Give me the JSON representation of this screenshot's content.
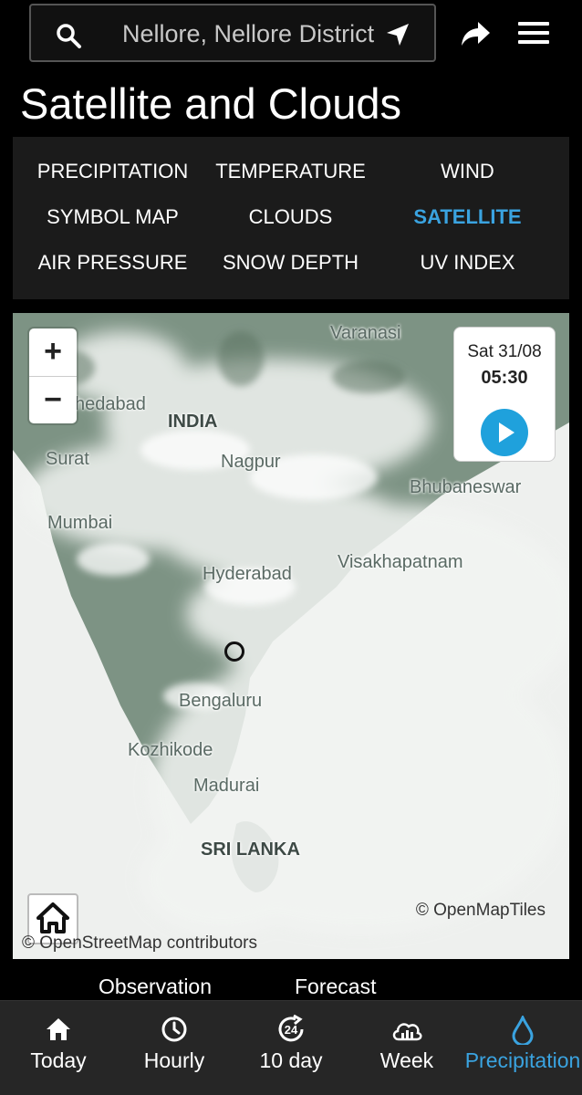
{
  "search": {
    "location_text": "Nellore, Nellore District"
  },
  "page": {
    "title": "Satellite and Clouds"
  },
  "map_types": [
    {
      "label": "PRECIPITATION",
      "active": false
    },
    {
      "label": "TEMPERATURE",
      "active": false
    },
    {
      "label": "WIND",
      "active": false
    },
    {
      "label": "SYMBOL MAP",
      "active": false
    },
    {
      "label": "CLOUDS",
      "active": false
    },
    {
      "label": "SATELLITE",
      "active": true
    },
    {
      "label": "AIR PRESSURE",
      "active": false
    },
    {
      "label": "SNOW DEPTH",
      "active": false
    },
    {
      "label": "UV INDEX",
      "active": false
    }
  ],
  "map": {
    "zoom_in": "+",
    "zoom_out": "−",
    "date": "Sat 31/08",
    "time": "05:30",
    "labels": {
      "varanasi": "Varanasi",
      "ahmedabad": "hedabad",
      "india": "INDIA",
      "surat": "Surat",
      "nagpur": "Nagpur",
      "bhubaneswar": "Bhubaneswar",
      "mumbai": "Mumbai",
      "hyderabad": "Hyderabad",
      "visakhapatnam": "Visakhapatnam",
      "bengaluru": "Bengaluru",
      "kozhikode": "Kozhikode",
      "madurai": "Madurai",
      "sri_lanka": "SRI LANKA"
    },
    "attribution_tiles": "© OpenMapTiles",
    "attribution_osm": "© OpenStreetMap contributors"
  },
  "sub_tabs": {
    "observation": "Observation",
    "forecast": "Forecast"
  },
  "bottom_nav": [
    {
      "label": "Today",
      "icon": "home-icon",
      "active": false
    },
    {
      "label": "Hourly",
      "icon": "clock-icon",
      "active": false
    },
    {
      "label": "10 day",
      "icon": "ten-day-icon",
      "badge": "24",
      "active": false
    },
    {
      "label": "Week",
      "icon": "cloud-chart-icon",
      "active": false
    },
    {
      "label": "Precipitation",
      "icon": "drop-icon",
      "active": true
    }
  ],
  "colors": {
    "accent": "#3aa3e0",
    "background": "#000000",
    "panel": "#1b1b1b",
    "nav": "#262626",
    "land": "#7d9384",
    "cloud": "#eef0ee"
  }
}
